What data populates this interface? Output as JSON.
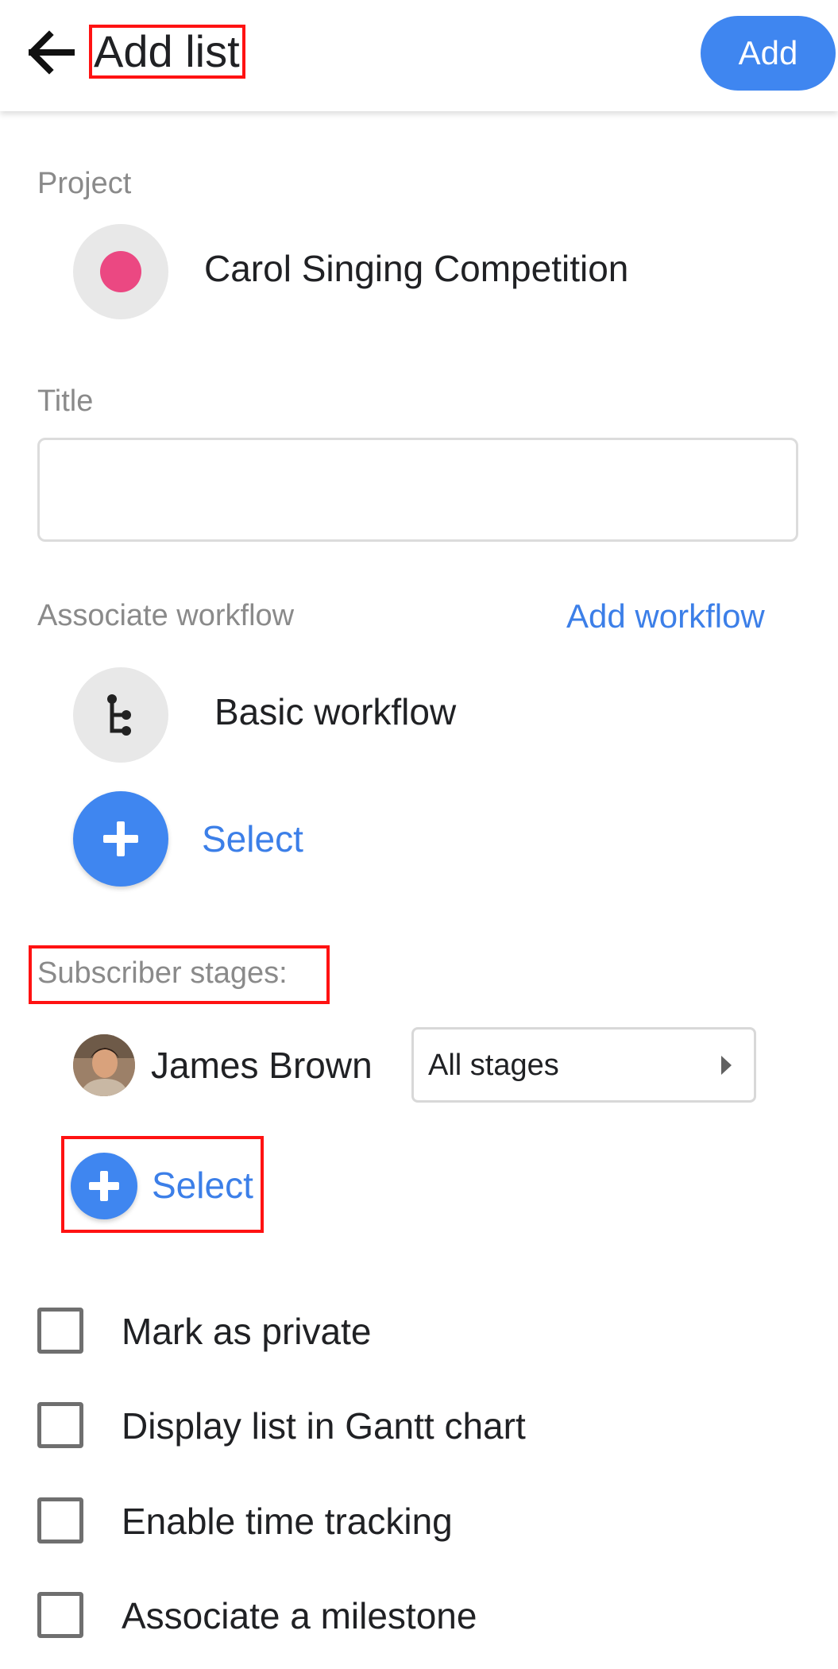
{
  "header": {
    "title": "Add list",
    "add_label": "Add"
  },
  "project": {
    "label": "Project",
    "name": "Carol Singing Competition",
    "color": "#eb4882"
  },
  "title_field": {
    "label": "Title",
    "value": "",
    "placeholder": ""
  },
  "workflow": {
    "label": "Associate workflow",
    "add_link": "Add workflow",
    "name": "Basic workflow",
    "icon": "workflow-tree-icon",
    "select_label": "Select"
  },
  "subscribers": {
    "label": "Subscriber stages:",
    "items": [
      {
        "name": "James Brown",
        "stage": "All stages"
      }
    ],
    "select_label": "Select"
  },
  "options": [
    {
      "label": "Mark as private",
      "checked": false
    },
    {
      "label": "Display list in Gantt chart",
      "checked": false
    },
    {
      "label": "Enable time tracking",
      "checked": false
    },
    {
      "label": "Associate a milestone",
      "checked": false
    }
  ],
  "colors": {
    "accent": "#3f86f0",
    "link": "#3c7fe8",
    "highlight_box": "#ff1212"
  }
}
